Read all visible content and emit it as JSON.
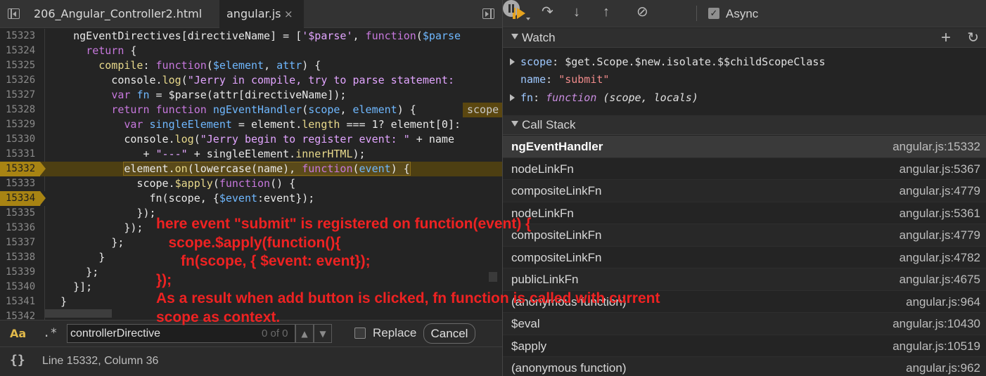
{
  "tabs": [
    {
      "label": "206_Angular_Controller2.html"
    },
    {
      "label": "angular.js",
      "close": "×"
    }
  ],
  "code_lines": [
    {
      "num": "15323"
    },
    {
      "num": "15324"
    },
    {
      "num": "15325"
    },
    {
      "num": "15326"
    },
    {
      "num": "15327"
    },
    {
      "num": "15328",
      "inline": "scope"
    },
    {
      "num": "15329"
    },
    {
      "num": "15330"
    },
    {
      "num": "15331"
    },
    {
      "num": "15332"
    },
    {
      "num": "15333"
    },
    {
      "num": "15334"
    },
    {
      "num": "15335"
    },
    {
      "num": "15336"
    },
    {
      "num": "15337"
    },
    {
      "num": "15338"
    },
    {
      "num": "15339"
    },
    {
      "num": "15340"
    },
    {
      "num": "15341"
    },
    {
      "num": "15342"
    }
  ],
  "search": {
    "case_label": "Aa",
    "regex_label": ".*",
    "query": "controllerDirective",
    "match_count": "0 of 0",
    "prev_glyph": "▲",
    "next_glyph": "▼",
    "replace_label": "Replace",
    "cancel_label": "Cancel"
  },
  "status": {
    "pretty_print_label": "{}",
    "cursor_position": "Line 15332, Column 36"
  },
  "annotation": [
    "here event \"submit\" is registered on function(event) {",
    "   scope.$apply(function(){",
    "      fn(scope, { $event: event});",
    "});",
    "As a result when add button is clicked, fn function is called with current",
    "scope as context."
  ],
  "debugger": {
    "async_label": "Async",
    "watch": {
      "title": "Watch",
      "add_glyph": "+",
      "refresh_glyph": "↻",
      "rows": [
        {
          "key": "scope",
          "value": "$get.Scope.$new.isolate.$$childScopeClass"
        },
        {
          "key": "name",
          "value": "\"submit\""
        },
        {
          "key": "fn",
          "fn_kw": "function",
          "args": "(scope, locals)"
        }
      ]
    },
    "call_stack": {
      "title": "Call Stack",
      "frames": [
        {
          "name": "ngEventHandler",
          "location": "angular.js:15332"
        },
        {
          "name": "nodeLinkFn",
          "location": "angular.js:5367"
        },
        {
          "name": "compositeLinkFn",
          "location": "angular.js:4779"
        },
        {
          "name": "nodeLinkFn",
          "location": "angular.js:5361"
        },
        {
          "name": "compositeLinkFn",
          "location": "angular.js:4779"
        },
        {
          "name": "compositeLinkFn",
          "location": "angular.js:4782"
        },
        {
          "name": "publicLinkFn",
          "location": "angular.js:4675"
        },
        {
          "name": "(anonymous function)",
          "location": "angular.js:964"
        },
        {
          "name": "$eval",
          "location": "angular.js:10430"
        },
        {
          "name": "$apply",
          "location": "angular.js:10519"
        },
        {
          "name": "(anonymous function)",
          "location": "angular.js:962"
        }
      ]
    }
  },
  "colors": {
    "breakpoint": "#a88413",
    "paused_line": "#4d3f12",
    "annotation": "#ee2222",
    "resume": "#e6a31e"
  }
}
